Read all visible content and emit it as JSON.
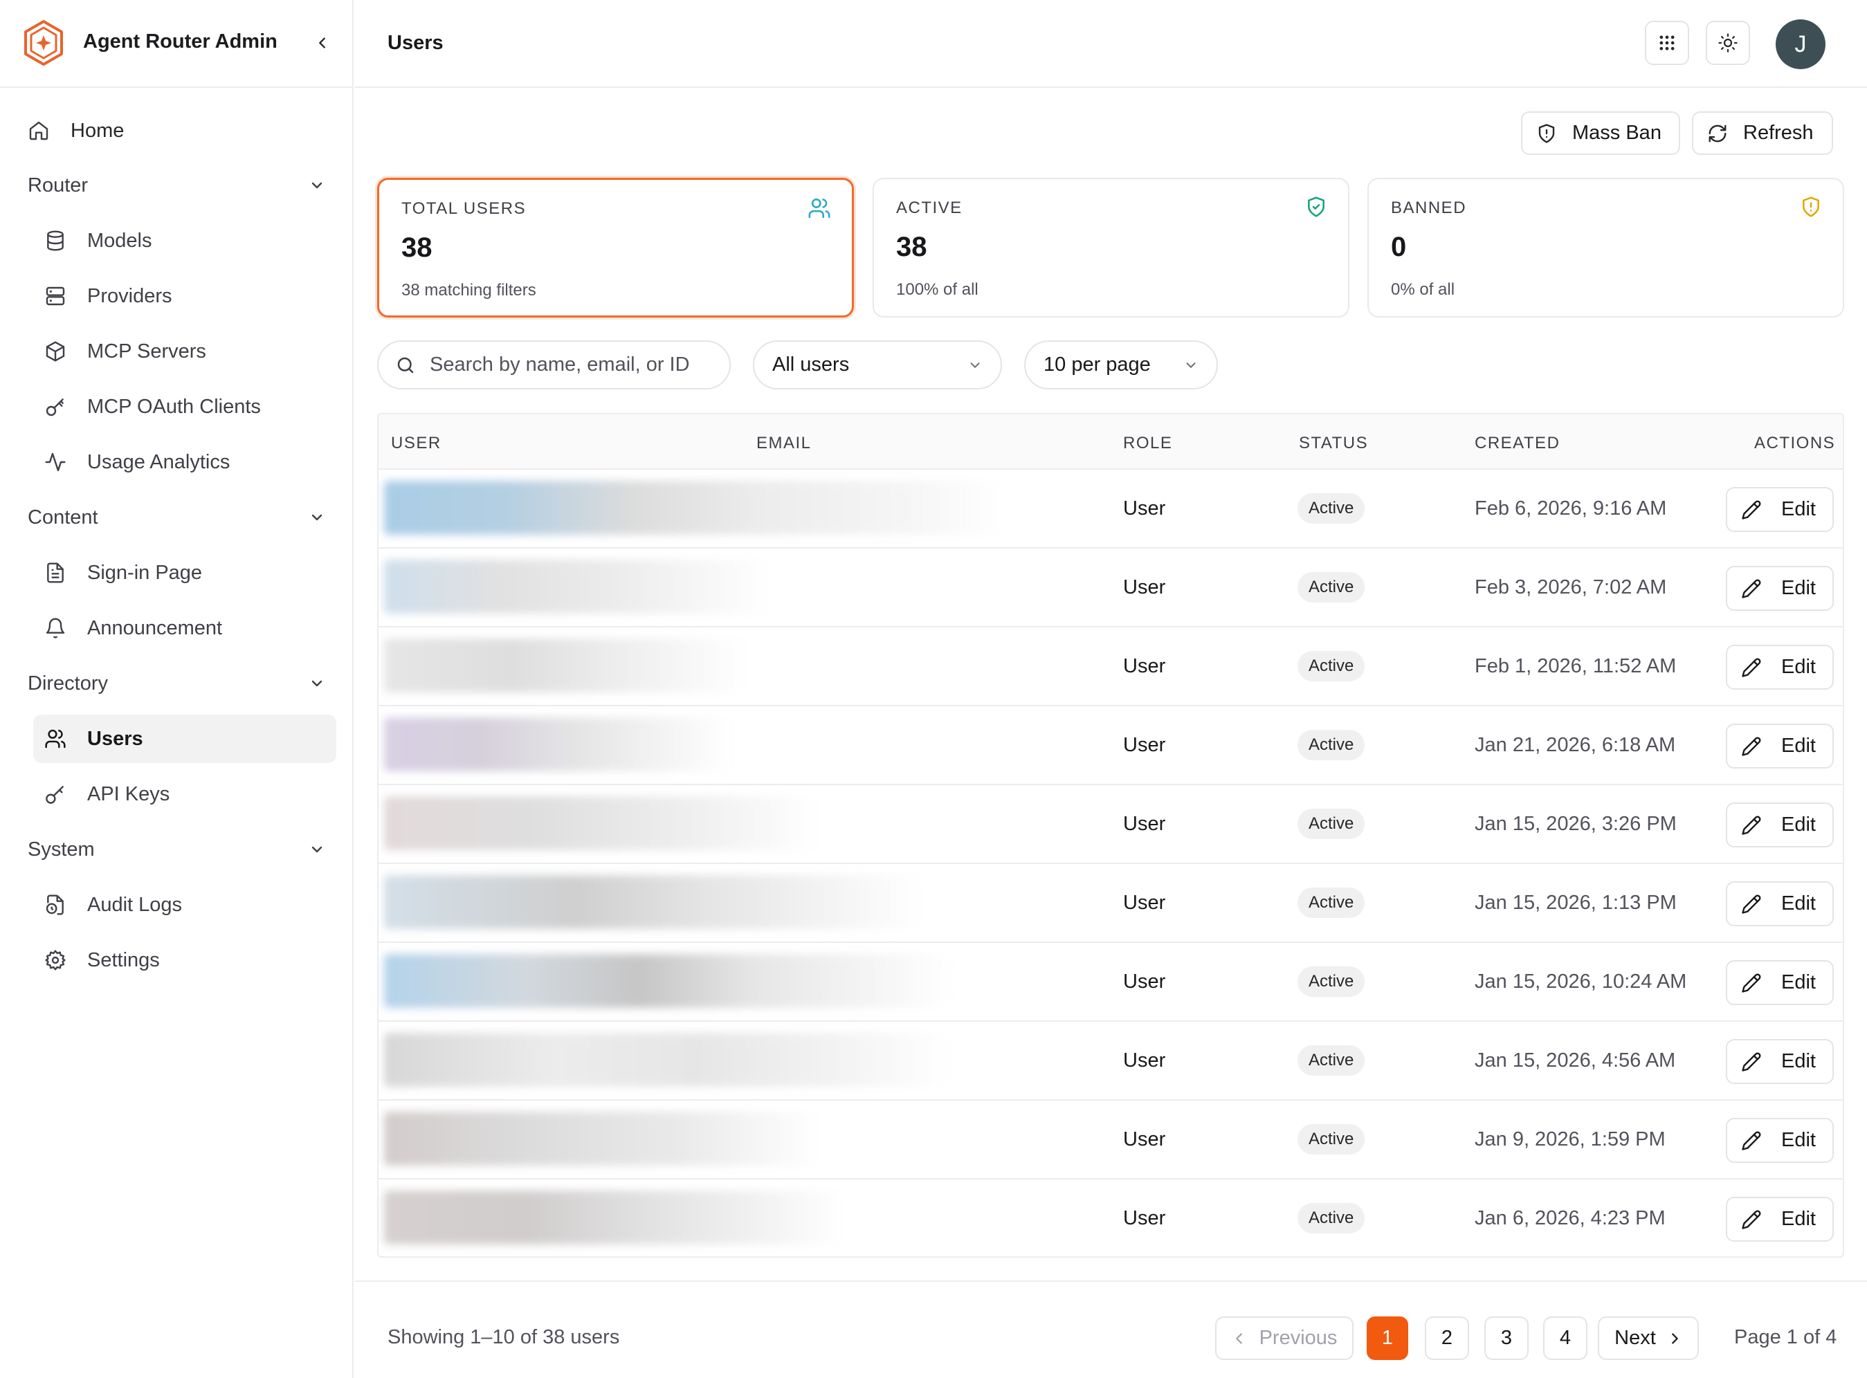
{
  "brand": {
    "title": "Agent Router Admin"
  },
  "nav": {
    "home": "Home",
    "groups": [
      {
        "label": "Router",
        "items": [
          "Models",
          "Providers",
          "MCP Servers",
          "MCP OAuth Clients",
          "Usage Analytics"
        ]
      },
      {
        "label": "Content",
        "items": [
          "Sign-in Page",
          "Announcement"
        ]
      },
      {
        "label": "Directory",
        "items": [
          "Users",
          "API Keys"
        ]
      },
      {
        "label": "System",
        "items": [
          "Audit Logs",
          "Settings"
        ]
      }
    ],
    "active": "Users"
  },
  "header": {
    "title": "Users",
    "avatar_initial": "J"
  },
  "toolbar": {
    "mass_ban": "Mass Ban",
    "refresh": "Refresh"
  },
  "stats": {
    "total": {
      "label": "TOTAL USERS",
      "value": "38",
      "sub": "38 matching filters"
    },
    "active": {
      "label": "ACTIVE",
      "value": "38",
      "sub": "100% of all"
    },
    "banned": {
      "label": "BANNED",
      "value": "0",
      "sub": "0% of all"
    }
  },
  "filters": {
    "search_placeholder": "Search by name, email, or ID",
    "user_filter": "All users",
    "per_page": "10 per page"
  },
  "table": {
    "columns": {
      "user": "USER",
      "email": "EMAIL",
      "role": "ROLE",
      "status": "STATUS",
      "created": "CREATED",
      "actions": "ACTIONS"
    },
    "edit_label": "Edit",
    "rows": [
      {
        "role": "User",
        "status": "Active",
        "created": "Feb 6, 2026, 9:16 AM"
      },
      {
        "role": "User",
        "status": "Active",
        "created": "Feb 3, 2026, 7:02 AM"
      },
      {
        "role": "User",
        "status": "Active",
        "created": "Feb 1, 2026, 11:52 AM"
      },
      {
        "role": "User",
        "status": "Active",
        "created": "Jan 21, 2026, 6:18 AM"
      },
      {
        "role": "User",
        "status": "Active",
        "created": "Jan 15, 2026, 3:26 PM"
      },
      {
        "role": "User",
        "status": "Active",
        "created": "Jan 15, 2026, 1:13 PM"
      },
      {
        "role": "User",
        "status": "Active",
        "created": "Jan 15, 2026, 10:24 AM"
      },
      {
        "role": "User",
        "status": "Active",
        "created": "Jan 15, 2026, 4:56 AM"
      },
      {
        "role": "User",
        "status": "Active",
        "created": "Jan 9, 2026, 1:59 PM"
      },
      {
        "role": "User",
        "status": "Active",
        "created": "Jan 6, 2026, 4:23 PM"
      }
    ]
  },
  "pagination": {
    "showing": "Showing 1–10 of 38 users",
    "previous": "Previous",
    "next": "Next",
    "pages": [
      "1",
      "2",
      "3",
      "4"
    ],
    "current": "1",
    "page_info": "Page 1 of 4"
  },
  "colors": {
    "accent": "#f25a0f",
    "brand": "#e8642c"
  }
}
